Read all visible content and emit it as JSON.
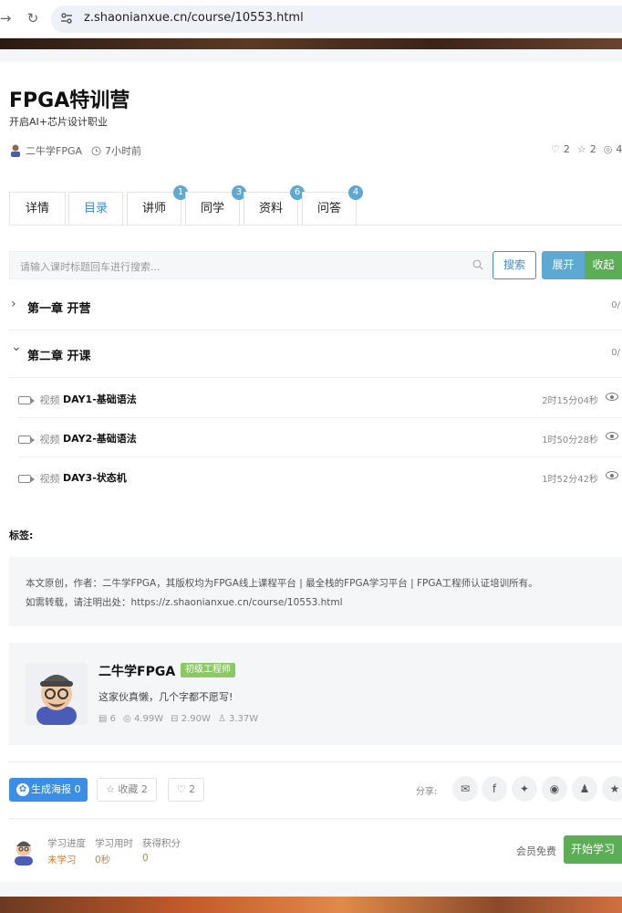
{
  "browser": {
    "url": "z.shaonianxue.cn/course/10553.html"
  },
  "course": {
    "title": "FPGA特训营",
    "subtitle": "开启AI+芯片设计职业",
    "author": "二牛学FPGA",
    "time_ago": "7小时前",
    "likes": "2",
    "favorites": "2",
    "views": "4"
  },
  "tabs": [
    {
      "label": "详情",
      "badge": ""
    },
    {
      "label": "目录",
      "badge": ""
    },
    {
      "label": "讲师",
      "badge": "1"
    },
    {
      "label": "同学",
      "badge": "3"
    },
    {
      "label": "资料",
      "badge": "6"
    },
    {
      "label": "问答",
      "badge": "4"
    }
  ],
  "search": {
    "placeholder": "请输入课时标题回车进行搜索...",
    "search_label": "搜索",
    "expand_label": "展开",
    "collapse_label": "收起"
  },
  "chapters": [
    {
      "title": "第一章  开营",
      "count": "0/",
      "arrow": "›"
    },
    {
      "title": "第二章  开课",
      "count": "0/",
      "arrow": "⌄"
    }
  ],
  "lessons": [
    {
      "type": "视频",
      "title": "DAY1-基础语法",
      "duration": "2时15分04秒"
    },
    {
      "type": "视频",
      "title": "DAY2-基础语法",
      "duration": "1时50分28秒"
    },
    {
      "type": "视频",
      "title": "DAY3-状态机",
      "duration": "1时52分42秒"
    }
  ],
  "tags_label": "标签:",
  "copyright": {
    "line1": "本文原创，作者：二牛学FPGA，其版权均为FPGA线上课程平台 | 最全栈的FPGA学习平台 | FPGA工程师认证培训所有。",
    "line2": "如需转载，请注明出处：https://z.shaonianxue.cn/course/10553.html"
  },
  "author_card": {
    "name": "二牛学FPGA",
    "level": "初级工程师",
    "bio": "这家伙真懒，几个字都不愿写!",
    "posts": "6",
    "views": "4.99W",
    "storage": "2.90W",
    "followers": "3.37W"
  },
  "actions": {
    "poster_label": "生成海报",
    "poster_count": "0",
    "favorite_label": "收藏",
    "favorite_count": "2",
    "like_count": "2",
    "share_label": "分享:"
  },
  "progress": {
    "progress_label": "学习进度",
    "progress_value": "未学习",
    "time_label": "学习用时",
    "time_value": "0秒",
    "points_label": "获得积分",
    "points_value": "0",
    "member_free": "会员免费",
    "start_label": "开始学习"
  }
}
